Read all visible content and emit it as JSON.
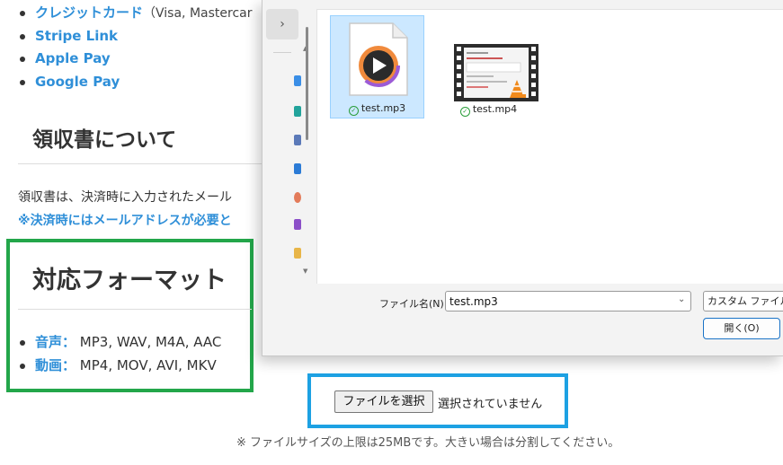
{
  "payment_methods": [
    {
      "label": "クレジットカード",
      "note": "（Visa, Mastercar"
    },
    {
      "label": "Stripe Link",
      "note": ""
    },
    {
      "label": "Apple Pay",
      "note": ""
    },
    {
      "label": "Google Pay",
      "note": ""
    }
  ],
  "receipt": {
    "heading": "領収書について",
    "text": "領収書は、決済時に入力されたメール",
    "note": "※決済時にはメールアドレスが必要と"
  },
  "formats": {
    "heading": "対応フォーマット",
    "items": [
      {
        "label": "音声：",
        "value": "MP3, WAV, M4A, AAC"
      },
      {
        "label": "動画：",
        "value": "MP4, MOV, AVI, MKV"
      }
    ]
  },
  "upload": {
    "button_label": "ファイルを選択",
    "status": "選択されていません",
    "note": "※ ファイルサイズの上限は25MBです。大きい場合は分割してください。"
  },
  "dialog": {
    "files": [
      {
        "name": "test.mp3",
        "icon": "audio-file-icon",
        "selected": true
      },
      {
        "name": "test.mp4",
        "icon": "video-file-icon",
        "selected": false
      }
    ],
    "filename_label": "ファイル名(N):",
    "filename_value": "test.mp3",
    "filetype_value": "カスタム ファイル (*.",
    "open_label": "開く(O)"
  },
  "colors": {
    "link": "#2f8fd8",
    "green_highlight": "#23a64a",
    "blue_highlight": "#1da1e3",
    "selection": "#cce8ff",
    "sync_ok": "#2a9d3a"
  }
}
